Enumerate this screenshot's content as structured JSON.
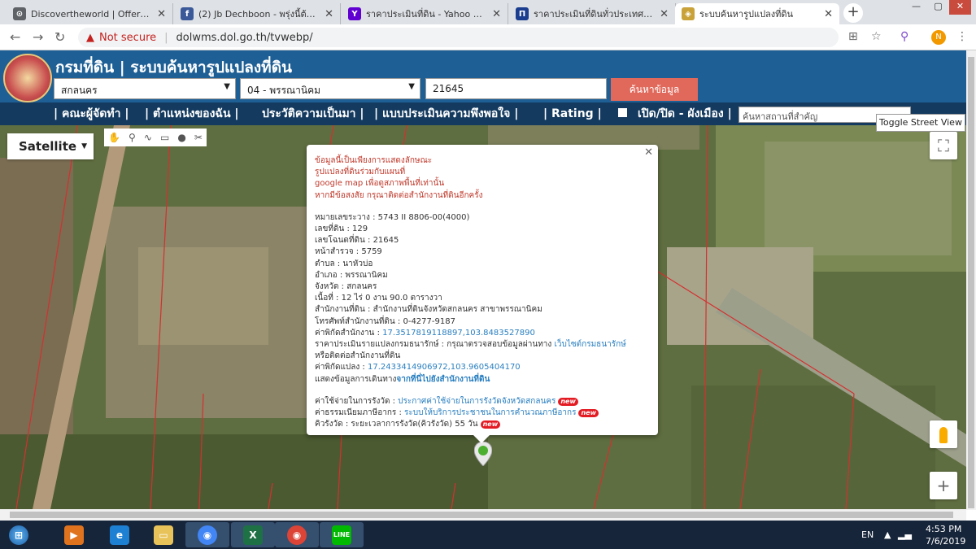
{
  "browser": {
    "tabs": [
      {
        "title": "Discovertheworld | Offers and Pro",
        "favicon": "discover-icon",
        "color": "#5f6368"
      },
      {
        "title": "(2) Jb Dechboon - พรุ่งนี้ต้องไปรีทร",
        "favicon": "facebook-icon",
        "color": "#3b5998"
      },
      {
        "title": "ราคาประเมินที่ดิน - Yahoo Search Re",
        "favicon": "yahoo-icon",
        "color": "#6001d2"
      },
      {
        "title": "ราคาประเมินที่ดินทั่วประเทศ | shopr",
        "favicon": "shop-icon",
        "color": "#1a3d8f"
      },
      {
        "title": "ระบบค้นหารูปแปลงที่ดิน",
        "favicon": "dol-icon",
        "color": "#c9a33a"
      }
    ],
    "window_controls": {
      "minimize": "—",
      "maximize": "▢",
      "close": "✕"
    },
    "security_label": "Not secure",
    "url": "dolwms.dol.go.th/tvwebp/",
    "profile_initial": "N"
  },
  "header": {
    "title": "กรมที่ดิน | ระบบค้นหารูปแปลงที่ดิน",
    "province": "สกลนคร",
    "district": "04 - พรรณานิคม",
    "deed_number": "21645",
    "search_label": "ค้นหาข้อมูล"
  },
  "menu": {
    "items": [
      "| คณะผู้จัดทำ |",
      "| ตำแหน่งของฉัน |",
      "ประวัติความเป็นมา |",
      "| แบบประเมินความพึงพอใจ |",
      "| Rating |",
      "เปิด/ปิด - ผังเมือง |"
    ],
    "place_search_placeholder": "ค้นหาสถานที่สำคัญ"
  },
  "map": {
    "type_label": "Satellite",
    "toggle_street_view": "Toggle Street View",
    "tools": [
      "✋",
      "⚲",
      "∿",
      "▭",
      "●",
      "✂"
    ]
  },
  "info": {
    "warnings": [
      "ข้อมูลนี้เป็นเพียงการแสดงลักษณะ",
      "รูปแปลงที่ดินร่วมกับแผนที่",
      "google map เพื่อดูสภาพพื้นที่เท่านั้น",
      "หากมีข้อสงสัย กรุณาติดต่อสำนักงานที่ดินอีกครั้ง"
    ],
    "fields": [
      {
        "label": "หมายเลขระวาง",
        "value": "5743 II 8806-00(4000)"
      },
      {
        "label": "เลขที่ดิน",
        "value": "129"
      },
      {
        "label": "เลขโฉนดที่ดิน",
        "value": "21645"
      },
      {
        "label": "หน้าสำรวจ",
        "value": "5759"
      },
      {
        "label": "ตำบล",
        "value": "นาหัวบ่อ"
      },
      {
        "label": "อำเภอ",
        "value": "พรรณานิคม"
      },
      {
        "label": "จังหวัด",
        "value": "สกลนคร"
      },
      {
        "label": "เนื้อที่",
        "value": "12 ไร่ 0 งาน 90.0 ตารางวา"
      },
      {
        "label": "สำนักงานที่ดิน",
        "value": "สำนักงานที่ดินจังหวัดสกลนคร สาขาพรรณานิคม"
      },
      {
        "label": "โทรศัพท์สำนักงานที่ดิน",
        "value": "0-4277-9187"
      }
    ],
    "office_coord_label": "ค่าพิกัดสำนักงาน",
    "office_coord": "17.3517819118897,103.8483527890",
    "appraisal_label": "ราคาประเมินรายแปลงกรมธนารักษ์",
    "appraisal_text": "กรุณาตรวจสอบข้อมูลผ่านทาง",
    "appraisal_link": "เว็บไซต์กรมธนารักษ์",
    "appraisal_text2": "หรือติดต่อสำนักงานที่ดิน",
    "parcel_coord_label": "ค่าพิกัดแปลง",
    "parcel_coord": "17.2433414906972,103.9605404170",
    "directions_label": "แสดงข้อมูลการเดินทาง",
    "directions_link": "จากที่นี่ไปยังสำนักงานที่ดิน",
    "fees": [
      {
        "label": "ค่าใช้จ่ายในการรังวัด",
        "value": "ประกาศค่าใช้จ่ายในการรังวัดจังหวัดสกลนคร"
      },
      {
        "label": "ค่าธรรมเนียมภาษีอากร",
        "value": "ระบบให้บริการประชาชนในการคำนวณภาษีอากร"
      },
      {
        "label": "คิวรังวัด",
        "value": "ระยะเวลาการรังวัด(คิวรังวัด) 55 วัน"
      }
    ],
    "new_badge": "new"
  },
  "taskbar": {
    "lang": "EN",
    "time": "4:53 PM",
    "date": "7/6/2019"
  }
}
